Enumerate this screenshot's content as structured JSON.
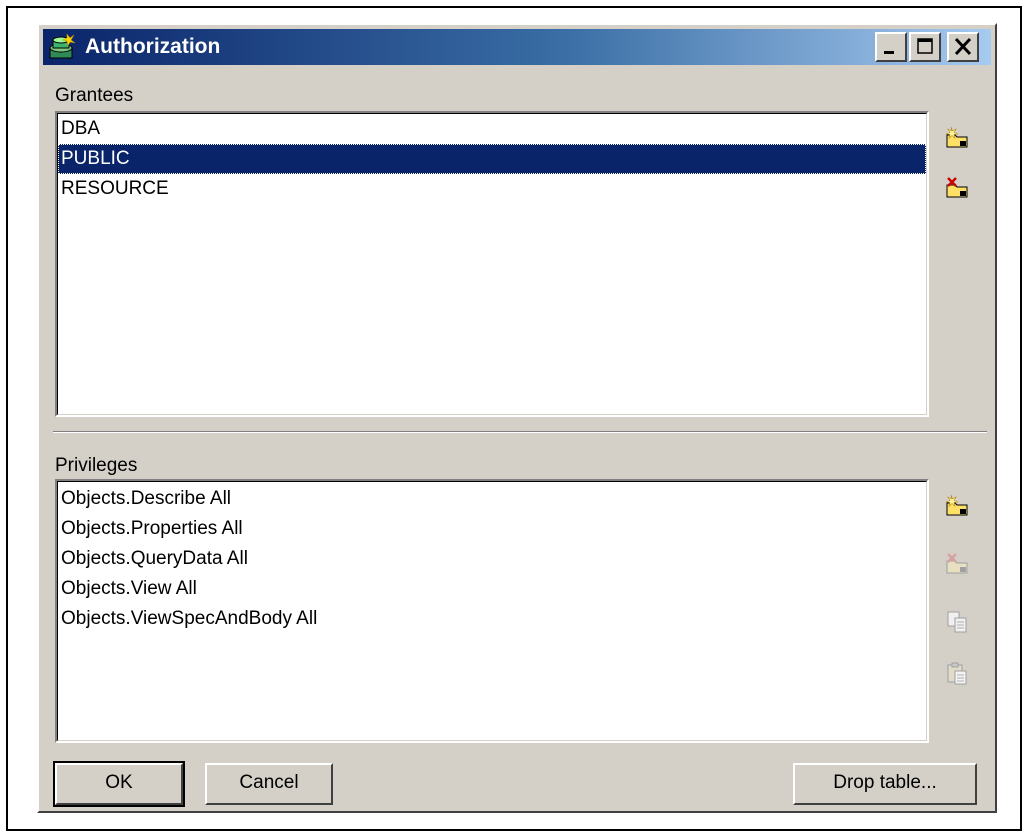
{
  "window": {
    "title": "Authorization",
    "controls": [
      "minimize-icon",
      "maximize-icon",
      "close-icon"
    ]
  },
  "grantees": {
    "label": "Grantees",
    "items": [
      "DBA",
      "PUBLIC",
      "RESOURCE"
    ],
    "selected": "PUBLIC",
    "actions": [
      "new-grantee-icon",
      "delete-grantee-icon"
    ]
  },
  "privileges": {
    "label": "Privileges",
    "items": [
      "Objects.Describe All",
      "Objects.Properties All",
      "Objects.QueryData All",
      "Objects.View All",
      "Objects.ViewSpecAndBody All"
    ],
    "actions": [
      "new-privilege-icon",
      "delete-privilege-icon",
      "copy-icon",
      "paste-icon"
    ]
  },
  "buttons": {
    "ok": "OK",
    "cancel": "Cancel",
    "drop_table": "Drop table..."
  },
  "colors": {
    "title_gradient_start": "#0a246a",
    "title_gradient_end": "#a6caf0",
    "selection": "#0a246a",
    "face": "#d4d0c8"
  }
}
